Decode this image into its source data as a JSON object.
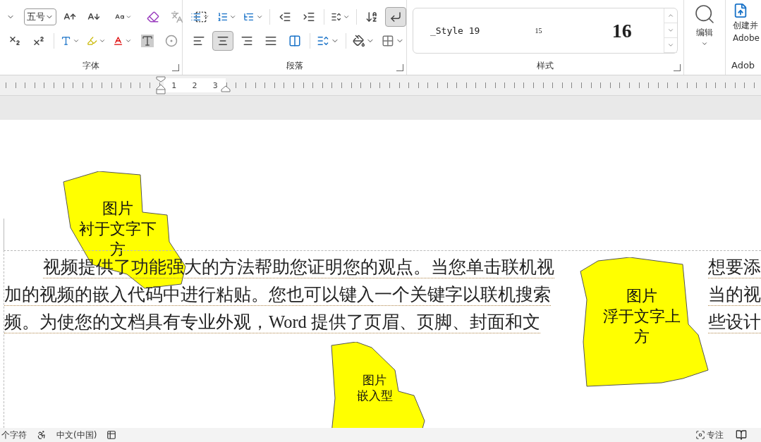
{
  "ribbon": {
    "font": {
      "size": "五号",
      "label": "字体"
    },
    "paragraph": {
      "label": "段落",
      "alignment": [
        {
          "kind": "left",
          "selected": false
        },
        {
          "kind": "center",
          "selected": true
        },
        {
          "kind": "right",
          "selected": false
        },
        {
          "kind": "justify",
          "selected": false
        },
        {
          "kind": "distributed",
          "selected": false
        }
      ],
      "show_marks": {
        "selected": true
      }
    },
    "styles": {
      "label": "样式",
      "items": [
        {
          "kind": "mono",
          "label": "_Style 19"
        },
        {
          "kind": "small",
          "label": "15"
        },
        {
          "kind": "heading",
          "label": "16"
        }
      ]
    },
    "editing": {
      "label": "编辑"
    },
    "adobe": {
      "button_lines": [
        "创建并",
        "Adobe"
      ],
      "label": "Adob"
    }
  },
  "ruler": {
    "numbers": [
      "1",
      "2",
      "3"
    ]
  },
  "document": {
    "lines": [
      {
        "segments": [
          "视频提供了功能强大的方法帮助您证明您的观点。当您单击联机视",
          "想要添"
        ]
      },
      {
        "segments": [
          "加的视频的嵌入代码中进行粘贴。您也可以键入一个关键字以联机搜索",
          "当的视"
        ]
      },
      {
        "segments": [
          "频。为使您的文档具有专业外观，Word 提供了页眉、页脚、封面和文",
          "些设计"
        ]
      }
    ],
    "shapes": [
      {
        "kind": "behind",
        "lines": [
          "图片",
          "衬于文字下",
          "方"
        ]
      },
      {
        "kind": "front",
        "lines": [
          "图片",
          "浮于文字上",
          "方"
        ]
      },
      {
        "kind": "inline",
        "lines": [
          "图片",
          "嵌入型"
        ]
      }
    ]
  },
  "status_bar": {
    "word_count": "个字符",
    "language": "中文(中国)",
    "focus": "专注"
  }
}
